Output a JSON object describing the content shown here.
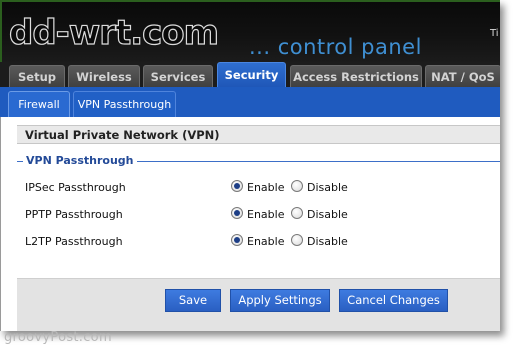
{
  "header": {
    "logo": "dd-wrt.com",
    "tagline": "... control panel",
    "time_fragment": "Ti"
  },
  "main_tabs": [
    {
      "label": "Setup",
      "active": false
    },
    {
      "label": "Wireless",
      "active": false
    },
    {
      "label": "Services",
      "active": false
    },
    {
      "label": "Security",
      "active": true
    },
    {
      "label": "Access Restrictions",
      "active": false
    },
    {
      "label": "NAT / QoS",
      "active": false
    }
  ],
  "sub_tabs": [
    {
      "label": "Firewall",
      "active": true
    },
    {
      "label": "VPN Passthrough",
      "active": false
    }
  ],
  "section": {
    "title": "Virtual Private Network (VPN)",
    "group_title": "VPN Passthrough",
    "rows": [
      {
        "label": "IPSec Passthrough",
        "value": "Enable"
      },
      {
        "label": "PPTP Passthrough",
        "value": "Enable"
      },
      {
        "label": "L2TP Passthrough",
        "value": "Enable"
      }
    ],
    "enable_label": "Enable",
    "disable_label": "Disable"
  },
  "buttons": {
    "save": "Save",
    "apply": "Apply Settings",
    "cancel": "Cancel Changes"
  },
  "watermark": "groovyPost.com",
  "colors": {
    "active_tab": "#1f57b8",
    "subbar": "#1f5bbf",
    "tagline": "#3f8fd2",
    "button": "#2a5fc2"
  }
}
